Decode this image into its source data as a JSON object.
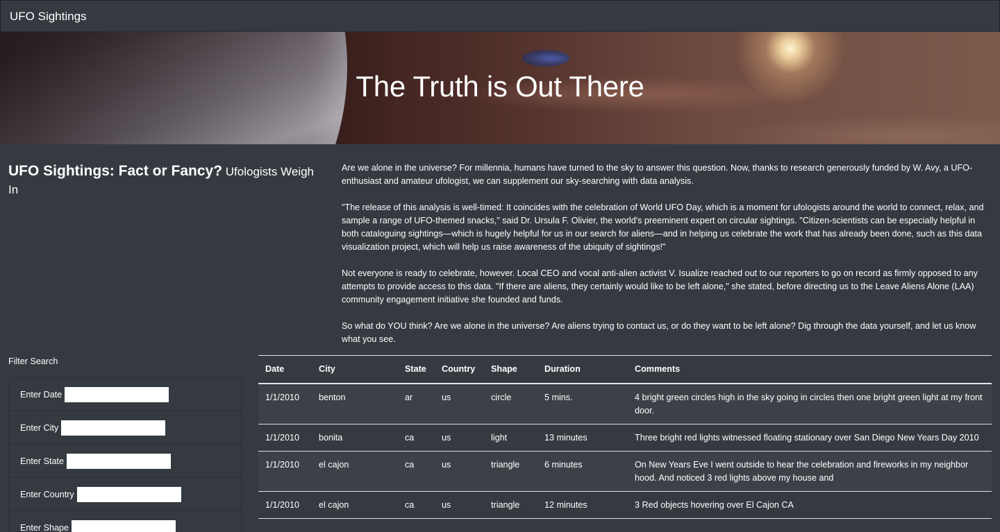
{
  "navbar": {
    "brand": "UFO Sightings"
  },
  "hero": {
    "title": "The Truth is Out There"
  },
  "headline": {
    "main": "UFO Sightings: Fact or Fancy?",
    "sub": "Ufologists Weigh In"
  },
  "article": {
    "paragraphs": [
      "Are we alone in the universe? For millennia, humans have turned to the sky to answer this question. Now, thanks to research generously funded by W. Avy, a UFO-enthusiast and amateur ufologist, we can supplement our sky-searching with data analysis.",
      "\"The release of this analysis is well-timed: It coincides with the celebration of World UFO Day, which is a moment for ufologists around the world to connect, relax, and sample a range of UFO-themed snacks,\" said Dr. Ursula F. Olivier, the world's preeminent expert on circular sightings. \"Citizen-scientists can be especially helpful in both cataloguing sightings—which is hugely helpful for us in our search for aliens—and in helping us celebrate the work that has already been done, such as this data visualization project, which will help us raise awareness of the ubiquity of sightings!\"",
      "Not everyone is ready to celebrate, however. Local CEO and vocal anti-alien activist V. Isualize reached out to our reporters to go on record as firmly opposed to any attempts to provide access to this data. \"If there are aliens, they certainly would like to be left alone,\" she stated, before directing us to the Leave Aliens Alone (LAA) community engagement initiative she founded and funds.",
      "So what do YOU think? Are we alone in the universe? Are aliens trying to contact us, or do they want to be left alone? Dig through the data yourself, and let us know what you see."
    ]
  },
  "filters": {
    "title": "Filter Search",
    "fields": [
      {
        "label": "Enter Date",
        "value": ""
      },
      {
        "label": "Enter City",
        "value": ""
      },
      {
        "label": "Enter State",
        "value": ""
      },
      {
        "label": "Enter Country",
        "value": ""
      },
      {
        "label": "Enter Shape",
        "value": ""
      }
    ]
  },
  "table": {
    "headers": [
      "Date",
      "City",
      "State",
      "Country",
      "Shape",
      "Duration",
      "Comments"
    ],
    "rows": [
      [
        "1/1/2010",
        "benton",
        "ar",
        "us",
        "circle",
        "5 mins.",
        "4 bright green circles high in the sky going in circles then one bright green light at my front door."
      ],
      [
        "1/1/2010",
        "bonita",
        "ca",
        "us",
        "light",
        "13 minutes",
        "Three bright red lights witnessed floating stationary over San Diego New Years Day 2010"
      ],
      [
        "1/1/2010",
        "el cajon",
        "ca",
        "us",
        "triangle",
        "6 minutes",
        "On New Years Eve I went outside to hear the celebration and fireworks in my neighbor hood. And noticed 3 red lights above my house and"
      ],
      [
        "1/1/2010",
        "el cajon",
        "ca",
        "us",
        "triangle",
        "12 minutes",
        "3 Red objects hovering over El Cajon CA"
      ]
    ]
  }
}
